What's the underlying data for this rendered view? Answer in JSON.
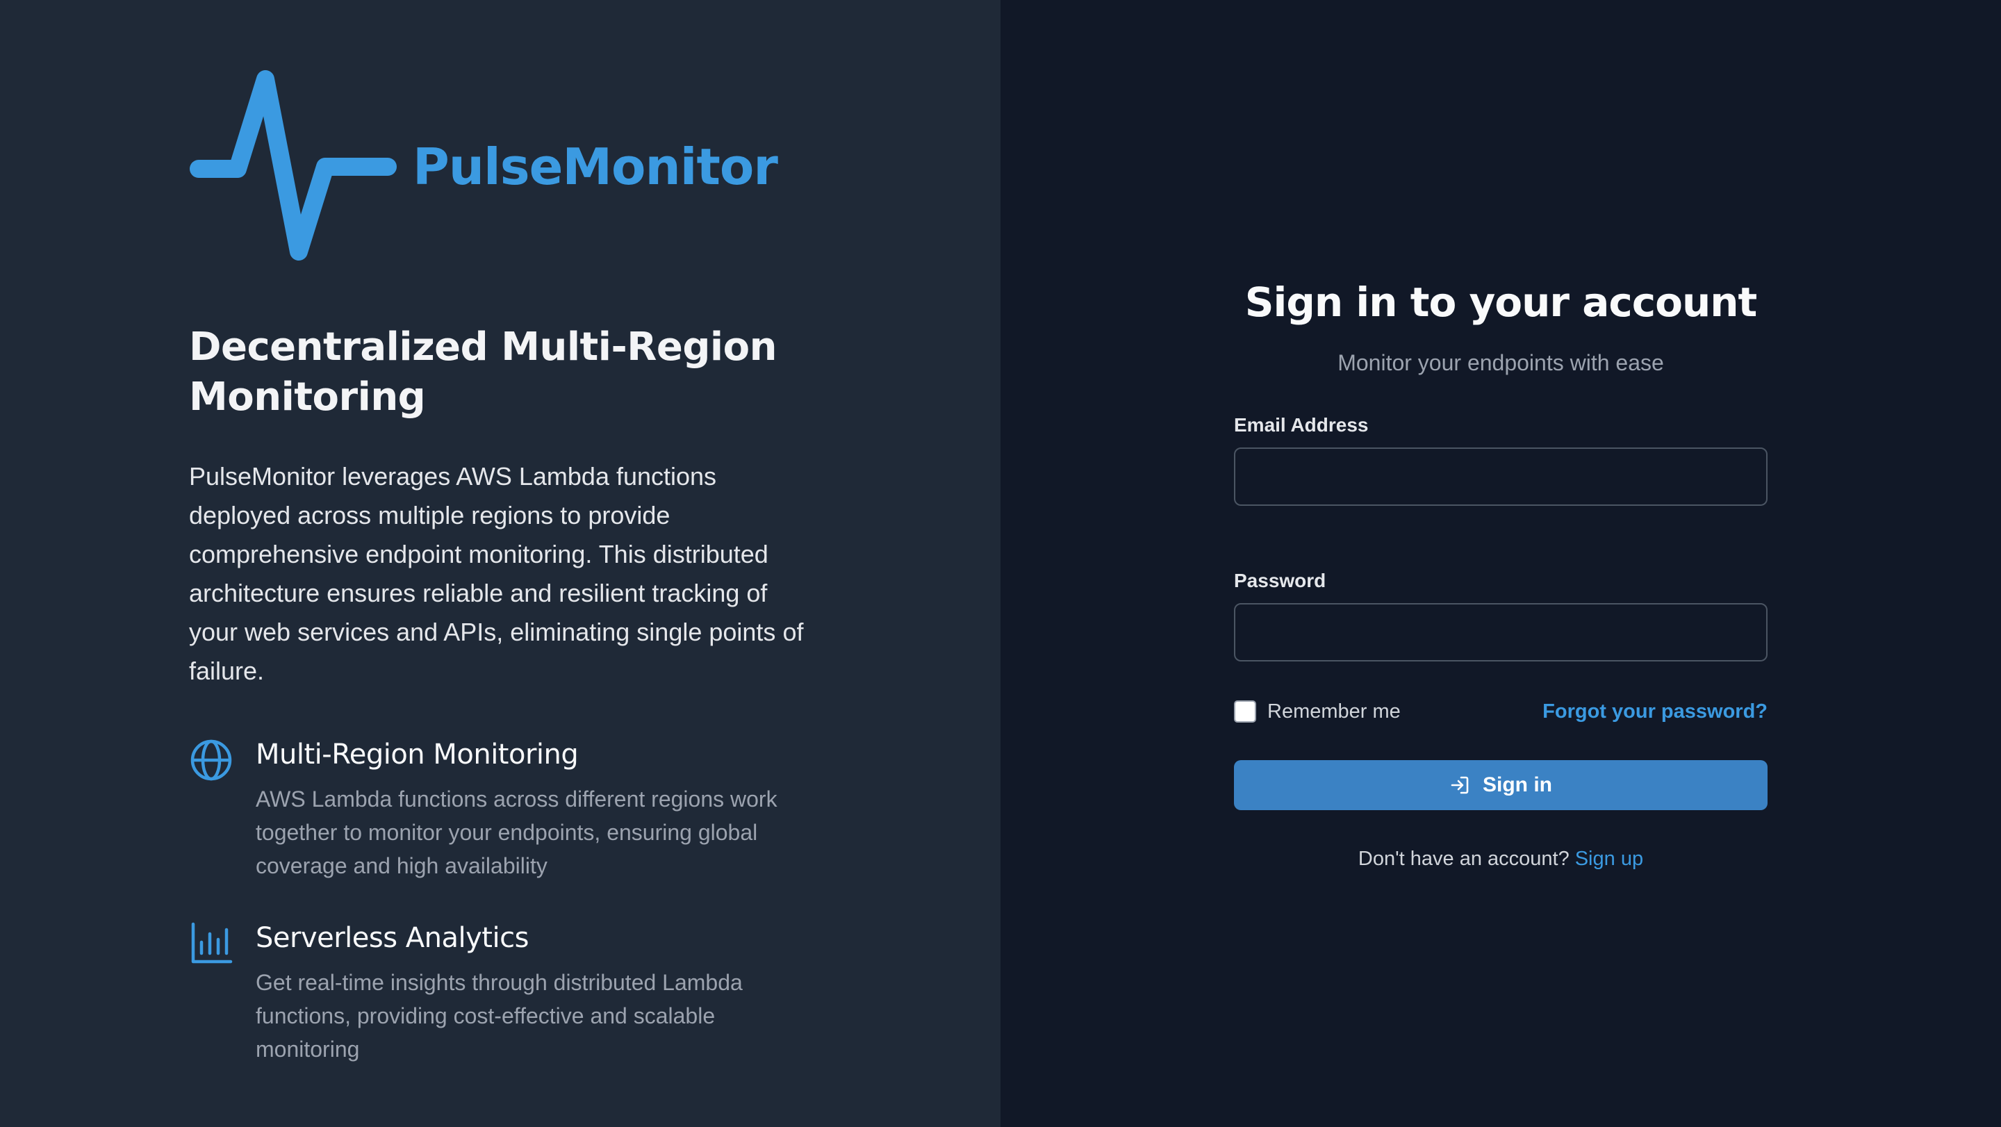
{
  "colors": {
    "left_bg": "#1f2937",
    "right_bg": "#111827",
    "accent": "#3b9ae1",
    "button_bg": "#3b82c4"
  },
  "brand": {
    "name": "PulseMonitor",
    "logo_icon": "pulse-line-icon"
  },
  "hero": {
    "headline": "Decentralized Multi-Region Monitoring",
    "description": "PulseMonitor leverages AWS Lambda functions deployed across multiple regions to provide comprehensive endpoint monitoring. This distributed architecture ensures reliable and resilient tracking of your web services and APIs, eliminating single points of failure."
  },
  "features": [
    {
      "icon": "globe-icon",
      "title": "Multi-Region Monitoring",
      "description": "AWS Lambda functions across different regions work together to monitor your endpoints, ensuring global coverage and high availability"
    },
    {
      "icon": "bar-chart-icon",
      "title": "Serverless Analytics",
      "description": "Get real-time insights through distributed Lambda functions, providing cost-effective and scalable monitoring"
    }
  ],
  "form": {
    "title": "Sign in to your account",
    "subtitle": "Monitor your endpoints with ease",
    "email_label": "Email Address",
    "email_value": "",
    "email_placeholder": "",
    "password_label": "Password",
    "password_value": "",
    "password_placeholder": "",
    "remember_label": "Remember me",
    "remember_checked": false,
    "forgot_label": "Forgot your password?",
    "signin_label": "Sign in",
    "signin_icon": "login-icon",
    "no_account_text": "Don't have an account?",
    "signup_label": "Sign up"
  }
}
